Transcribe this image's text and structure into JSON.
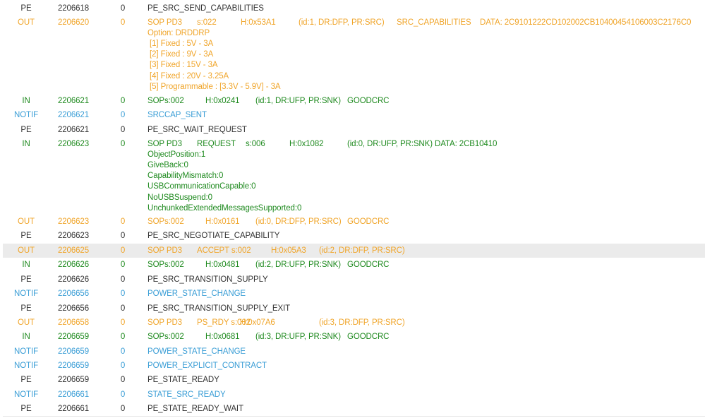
{
  "colors": {
    "pe": "#333333",
    "out": "#f0a52a",
    "in": "#1f8a1f",
    "notif": "#3b9ed6",
    "selected_row": "#ebebeb"
  },
  "rows": [
    {
      "type": "PE",
      "kind": "pe",
      "time": "2206618",
      "port": "0",
      "segments": [
        "PE_SRC_SEND_CAPABILITIES"
      ]
    },
    {
      "type": "OUT",
      "kind": "out",
      "time": "2206620",
      "port": "0",
      "segments": [
        "SOP PD3",
        "s:022",
        "H:0x53A1",
        "(id:1, DR:DFP, PR:SRC)",
        "SRC_CAPABILITIES",
        "DATA: 2C9101222CD102002CB10400454106003C2176C0"
      ],
      "details": [
        "Option:  DRDDRP",
        "[1] Fixed : 5V - 3A",
        "[2] Fixed : 9V - 3A",
        "[3] Fixed : 15V - 3A",
        "[4] Fixed : 20V - 3.25A",
        "[5] Programmable : [3.3V - 5.9V] - 3A"
      ]
    },
    {
      "type": "IN",
      "kind": "in",
      "time": "2206621",
      "port": "0",
      "segments": [
        "SOPs:002",
        "H:0x0241",
        "(id:1, DR:UFP, PR:SNK)",
        "GOODCRC"
      ]
    },
    {
      "type": "NOTIF",
      "kind": "notif",
      "time": "2206621",
      "port": "0",
      "segments": [
        "SRCCAP_SENT"
      ]
    },
    {
      "type": "PE",
      "kind": "pe",
      "time": "2206621",
      "port": "0",
      "segments": [
        "PE_SRC_WAIT_REQUEST"
      ]
    },
    {
      "type": "IN",
      "kind": "in",
      "time": "2206623",
      "port": "0",
      "segments": [
        "SOP PD3",
        "REQUEST",
        "s:006",
        "H:0x1082",
        "(id:0, DR:UFP, PR:SNK)  DATA: 2CB10410"
      ],
      "details": [
        "ObjectPosition:1",
        "GiveBack:0",
        "CapabilityMismatch:0",
        "USBCommunicationCapable:0",
        "NoUSBSuspend:0",
        "UnchunkedExtendedMessagesSupported:0"
      ]
    },
    {
      "type": "OUT",
      "kind": "out",
      "time": "2206623",
      "port": "0",
      "segments": [
        "SOPs:002",
        "H:0x0161",
        "(id:0, DR:DFP, PR:SRC)",
        "GOODCRC"
      ]
    },
    {
      "type": "PE",
      "kind": "pe",
      "time": "2206623",
      "port": "0",
      "segments": [
        "PE_SRC_NEGOTIATE_CAPABILITY"
      ]
    },
    {
      "type": "OUT",
      "kind": "out",
      "time": "2206625",
      "port": "0",
      "selected": true,
      "segments": [
        "SOP PD3",
        "ACCEPT s:002",
        "H:0x05A3",
        "(id:2, DR:DFP, PR:SRC)"
      ]
    },
    {
      "type": "IN",
      "kind": "in",
      "time": "2206626",
      "port": "0",
      "segments": [
        "SOPs:002",
        "H:0x0481",
        "(id:2, DR:UFP, PR:SNK)",
        "GOODCRC"
      ]
    },
    {
      "type": "PE",
      "kind": "pe",
      "time": "2206626",
      "port": "0",
      "segments": [
        "PE_SRC_TRANSITION_SUPPLY"
      ]
    },
    {
      "type": "NOTIF",
      "kind": "notif",
      "time": "2206656",
      "port": "0",
      "segments": [
        "POWER_STATE_CHANGE"
      ]
    },
    {
      "type": "PE",
      "kind": "pe",
      "time": "2206656",
      "port": "0",
      "segments": [
        "PE_SRC_TRANSITION_SUPPLY_EXIT"
      ]
    },
    {
      "type": "OUT",
      "kind": "out",
      "time": "2206658",
      "port": "0",
      "segments": [
        "SOP PD3",
        "PS_RDY  s:002",
        "H:0x07A6",
        "(id:3, DR:DFP, PR:SRC)"
      ]
    },
    {
      "type": "IN",
      "kind": "in",
      "time": "2206659",
      "port": "0",
      "segments": [
        "SOPs:002",
        "H:0x0681",
        "(id:3, DR:UFP, PR:SNK)",
        "GOODCRC"
      ]
    },
    {
      "type": "NOTIF",
      "kind": "notif",
      "time": "2206659",
      "port": "0",
      "segments": [
        "POWER_STATE_CHANGE"
      ]
    },
    {
      "type": "NOTIF",
      "kind": "notif",
      "time": "2206659",
      "port": "0",
      "segments": [
        "POWER_EXPLICIT_CONTRACT"
      ]
    },
    {
      "type": "PE",
      "kind": "pe",
      "time": "2206659",
      "port": "0",
      "segments": [
        "PE_STATE_READY"
      ]
    },
    {
      "type": "NOTIF",
      "kind": "notif",
      "time": "2206661",
      "port": "0",
      "segments": [
        "STATE_SRC_READY"
      ]
    },
    {
      "type": "PE",
      "kind": "pe",
      "time": "2206661",
      "port": "0",
      "segments": [
        "PE_STATE_READY_WAIT"
      ]
    }
  ]
}
